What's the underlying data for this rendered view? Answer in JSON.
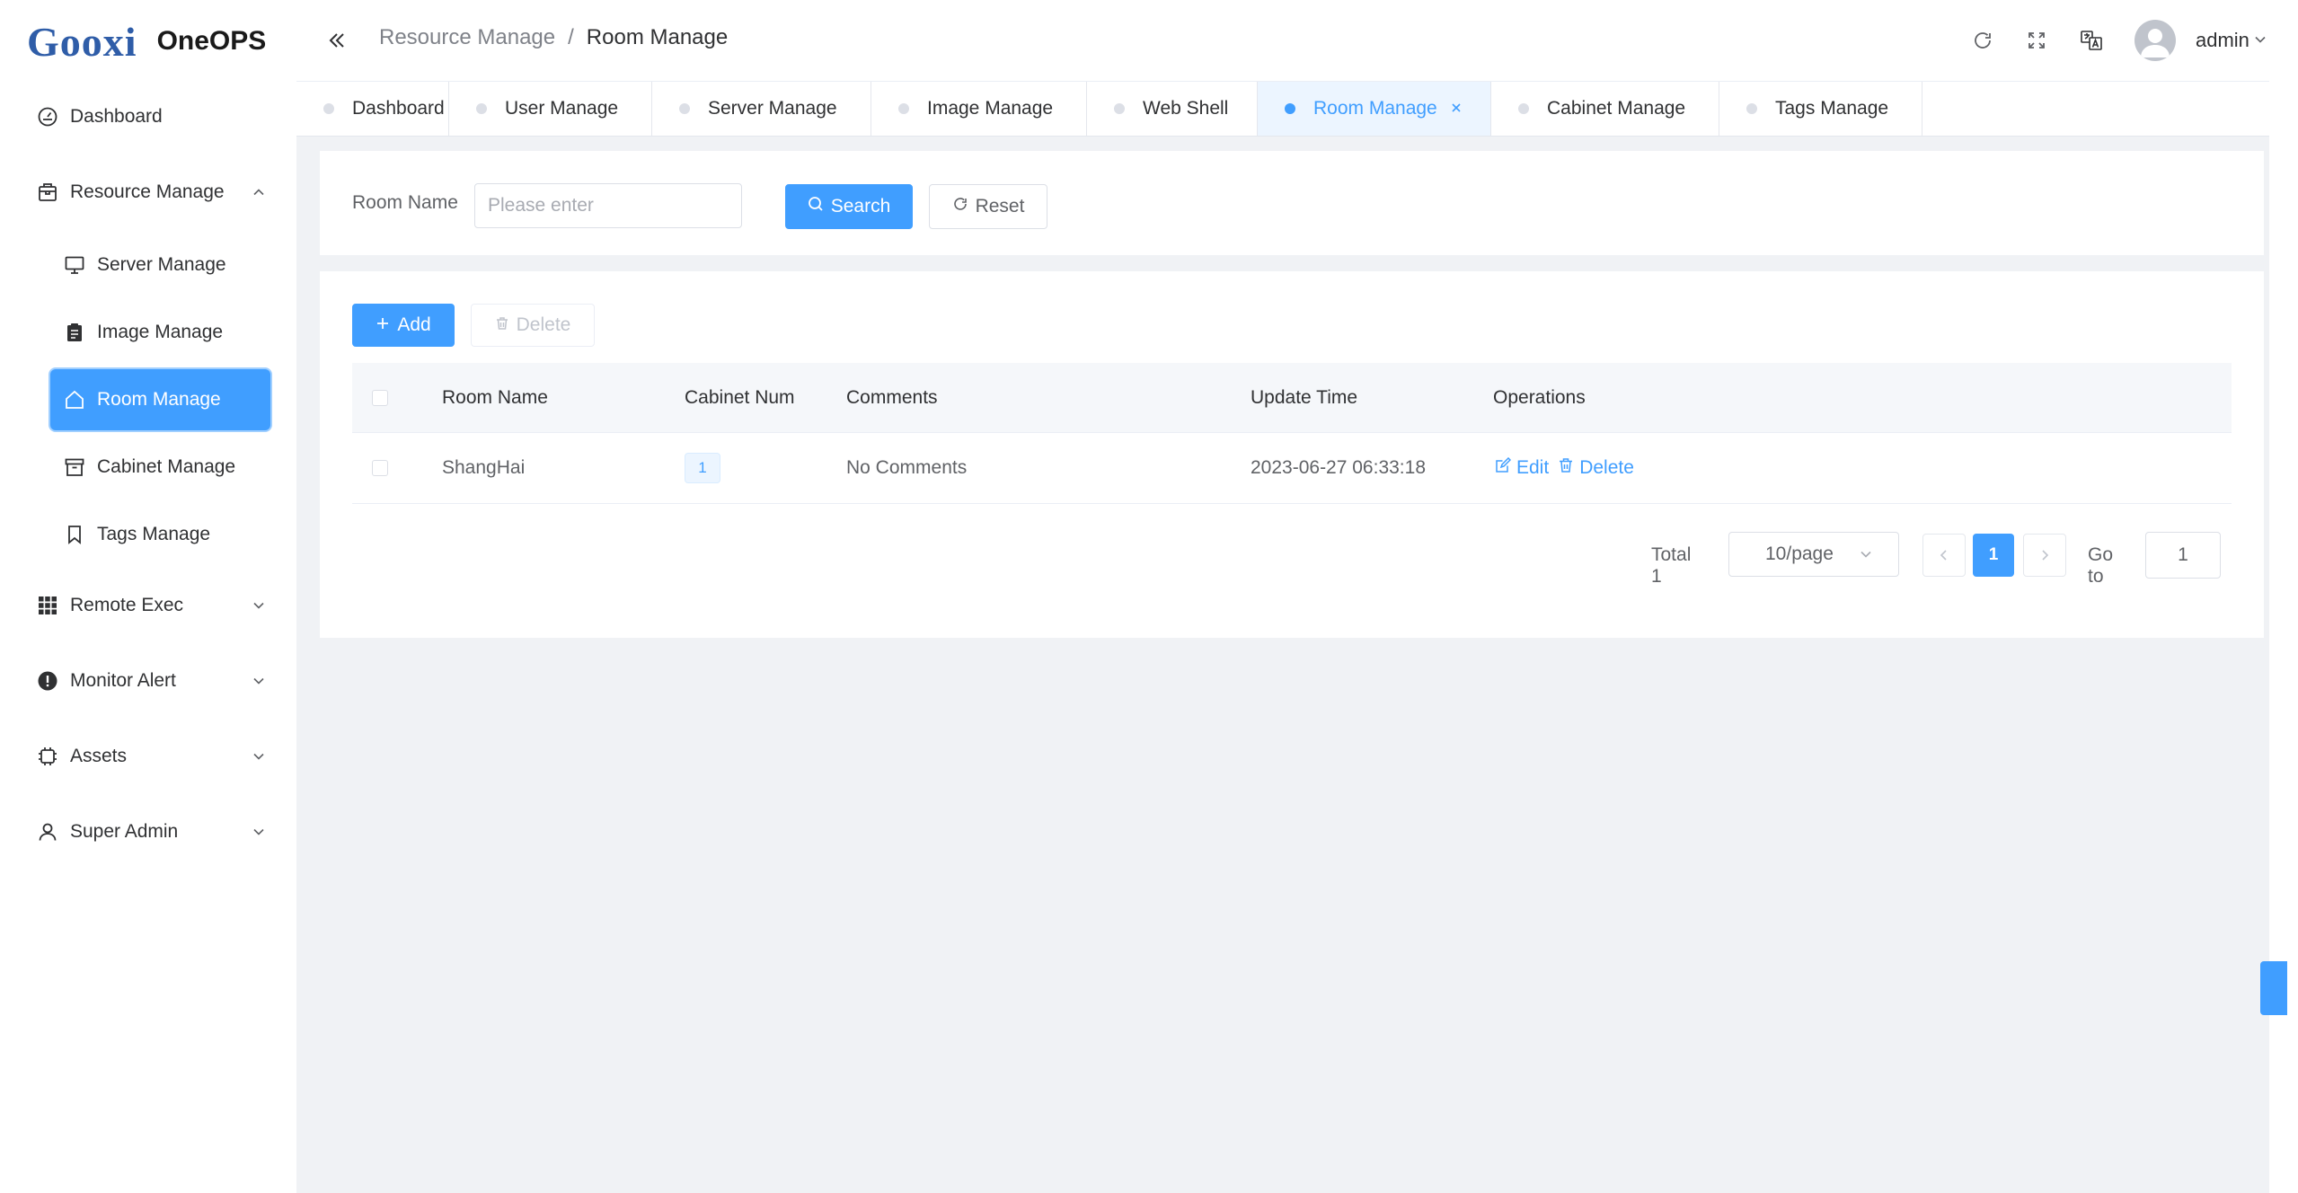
{
  "brand": {
    "logo": "Gooxi",
    "app": "OneOPS"
  },
  "header": {
    "breadcrumb": [
      "Resource Manage",
      "/",
      "Room Manage"
    ],
    "user": "admin"
  },
  "sidebar": {
    "dashboard": "Dashboard",
    "resource": "Resource Manage",
    "sub": [
      "Server Manage",
      "Image Manage",
      "Room Manage",
      "Cabinet Manage",
      "Tags Manage"
    ],
    "remote": "Remote Exec",
    "monitor": "Monitor Alert",
    "assets": "Assets",
    "superadmin": "Super Admin"
  },
  "tabs": [
    "Dashboard",
    "User Manage",
    "Server Manage",
    "Image Manage",
    "Web Shell",
    "Room Manage",
    "Cabinet Manage",
    "Tags Manage"
  ],
  "active_tab": "Room Manage",
  "search": {
    "label": "Room Name",
    "placeholder": "Please enter",
    "search_btn": "Search",
    "reset_btn": "Reset"
  },
  "toolbar": {
    "add": "Add",
    "delete": "Delete"
  },
  "table": {
    "columns": [
      "Room Name",
      "Cabinet Num",
      "Comments",
      "Update Time",
      "Operations"
    ],
    "rows": [
      {
        "room_name": "ShangHai",
        "cabinet_num": "1",
        "comments": "No Comments",
        "update_time": "2023-06-27 06:33:18",
        "edit": "Edit",
        "delete": "Delete"
      }
    ]
  },
  "pagination": {
    "total": "Total 1",
    "page_size": "10/page",
    "current_page": "1",
    "goto_label": "Go to",
    "goto_value": "1"
  },
  "colors": {
    "primary": "#409eff",
    "brand": "#2f5da8"
  }
}
